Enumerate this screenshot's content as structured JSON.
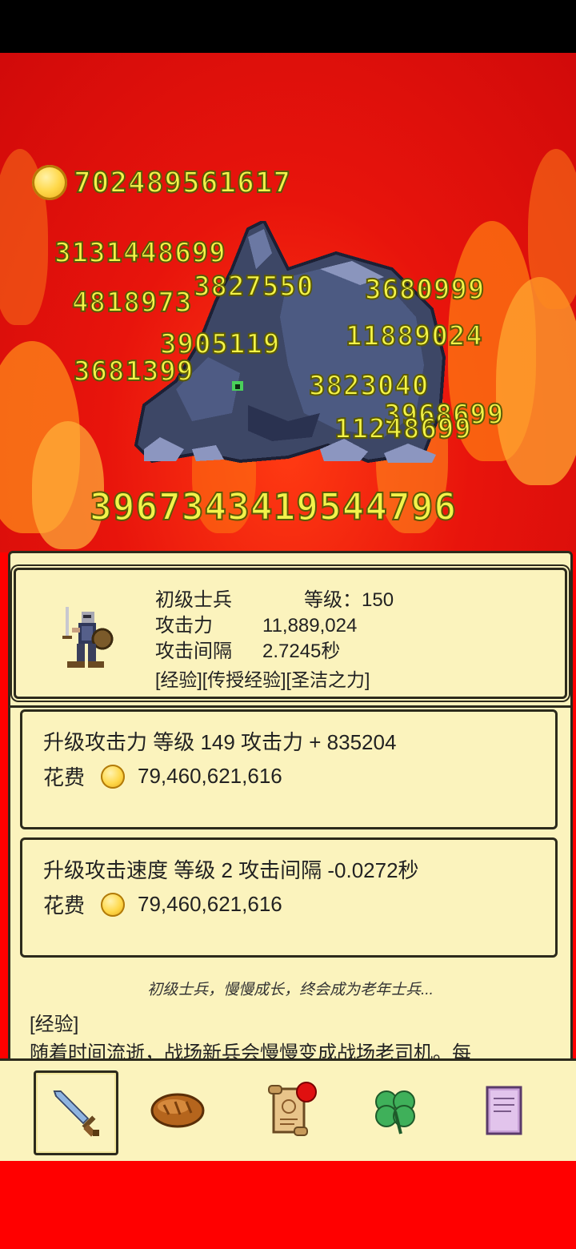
{
  "header": {
    "total_coins": "702489561617"
  },
  "arena": {
    "damage_numbers": [
      "3131448699",
      "3827550",
      "3680999",
      "4818973",
      "11889024",
      "3905119",
      "3681399",
      "3823040",
      "3968699",
      "11248699"
    ],
    "monster_hp": "3967343419544796"
  },
  "unit": {
    "name": "初级士兵",
    "level_label": "等级：150",
    "attack_label": "攻击力",
    "attack_value": "11,889,024",
    "interval_label": "攻击间隔",
    "interval_value": "2.7245秒",
    "links": "[经验][传授经验][圣洁之力]"
  },
  "upgrades": [
    {
      "title": "升级攻击力 等级 149   攻击力 + 835204",
      "cost_label": "花费",
      "cost": "79,460,621,616"
    },
    {
      "title": "升级攻击速度 等级 2    攻击间隔 -0.0272秒",
      "cost_label": "花费",
      "cost": "79,460,621,616"
    }
  ],
  "description": "初级士兵，慢慢成长，终会成为老年士兵...",
  "experience": {
    "title": "[经验]",
    "text": "随着时间流逝，战场新兵会慢慢变成战场老司机。每"
  },
  "tabs": [
    {
      "icon": "sword-icon",
      "active": true
    },
    {
      "icon": "bread-icon",
      "active": false
    },
    {
      "icon": "scroll-icon",
      "active": false,
      "badge": true
    },
    {
      "icon": "clover-icon",
      "active": false
    },
    {
      "icon": "book-icon",
      "active": false
    }
  ],
  "colors": {
    "accent_gold": "#f3f34a",
    "panel_bg": "#fbf3bd",
    "frame": "#2c2a1c",
    "fire_red": "#e8140c"
  }
}
